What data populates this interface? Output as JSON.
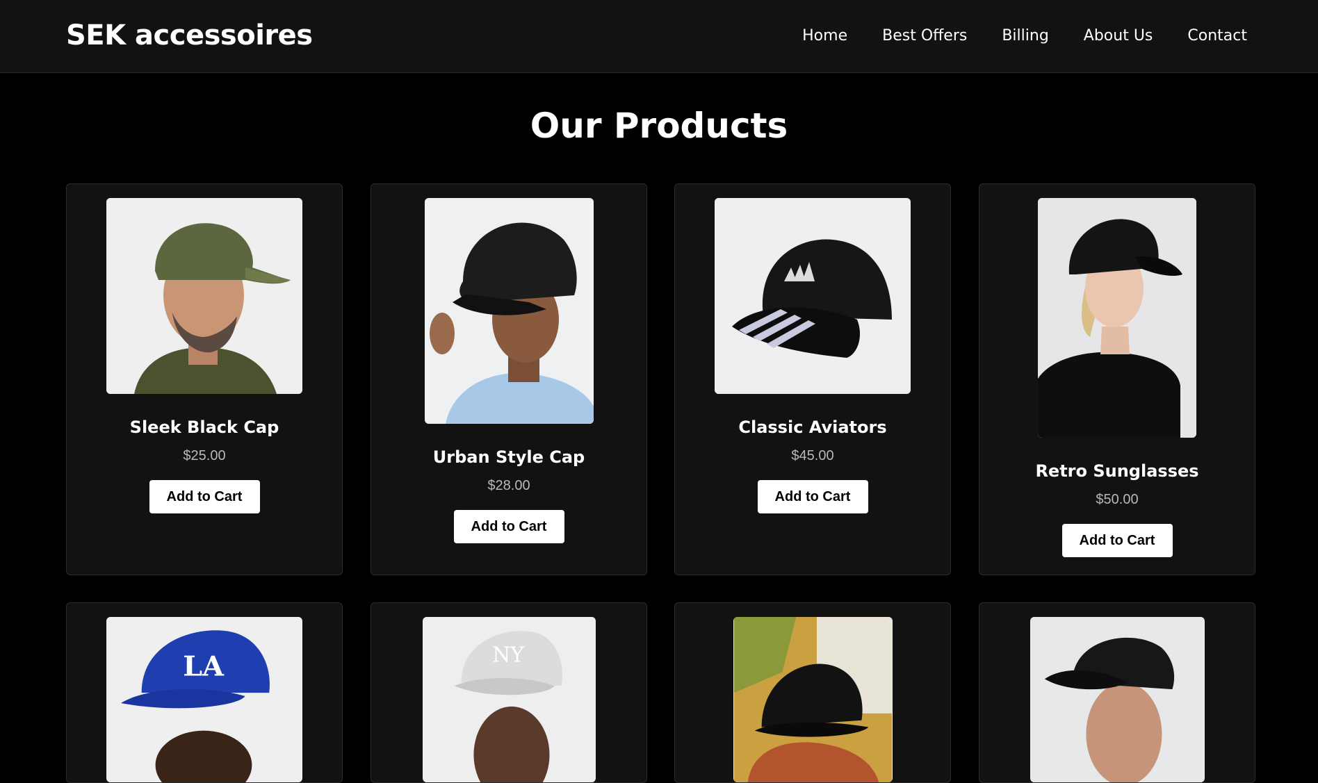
{
  "header": {
    "logo": "SEK accessoires",
    "nav": [
      "Home",
      "Best Offers",
      "Billing",
      "About Us",
      "Contact"
    ]
  },
  "main": {
    "title": "Our Products",
    "products": [
      {
        "name": "Sleek Black Cap",
        "price": "$25.00",
        "button": "Add to Cart",
        "image_icon": "olive-cap-man-photo"
      },
      {
        "name": "Urban Style Cap",
        "price": "$28.00",
        "button": "Add to Cart",
        "image_icon": "black-cap-man-photo"
      },
      {
        "name": "Classic Aviators",
        "price": "$45.00",
        "button": "Add to Cart",
        "image_icon": "black-striped-cap-photo"
      },
      {
        "name": "Retro Sunglasses",
        "price": "$50.00",
        "button": "Add to Cart",
        "image_icon": "black-cap-woman-photo"
      },
      {
        "image_icon": "blue-la-cap-photo"
      },
      {
        "image_icon": "white-ny-cap-photo"
      },
      {
        "image_icon": "black-cap-woman-outdoor-photo"
      },
      {
        "image_icon": "black-cap-man-profile-photo"
      }
    ]
  },
  "colors": {
    "background": "#000000",
    "header": "#121212",
    "card": "#121212",
    "button": "#ffffff",
    "price": "#b9b9b9"
  }
}
